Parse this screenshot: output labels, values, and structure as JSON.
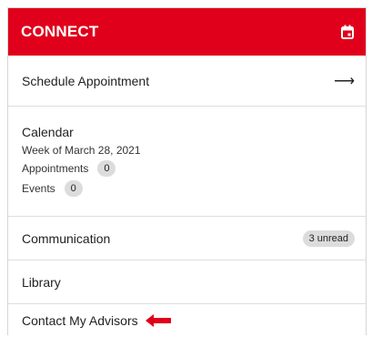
{
  "header": {
    "title": "CONNECT",
    "icon": "calendar-icon",
    "bg_color": "#e0001b"
  },
  "schedule": {
    "label": "Schedule Appointment",
    "icon": "arrow-right-icon"
  },
  "calendar": {
    "title": "Calendar",
    "week": "Week of March 28, 2021",
    "appointments_label": "Appointments",
    "appointments_count": "0",
    "events_label": "Events",
    "events_count": "0"
  },
  "communication": {
    "label": "Communication",
    "badge": "3 unread"
  },
  "library": {
    "label": "Library"
  },
  "contact": {
    "label": "Contact My Advisors",
    "annotation_icon": "red-arrow-icon",
    "annotation_color": "#e0001b"
  }
}
